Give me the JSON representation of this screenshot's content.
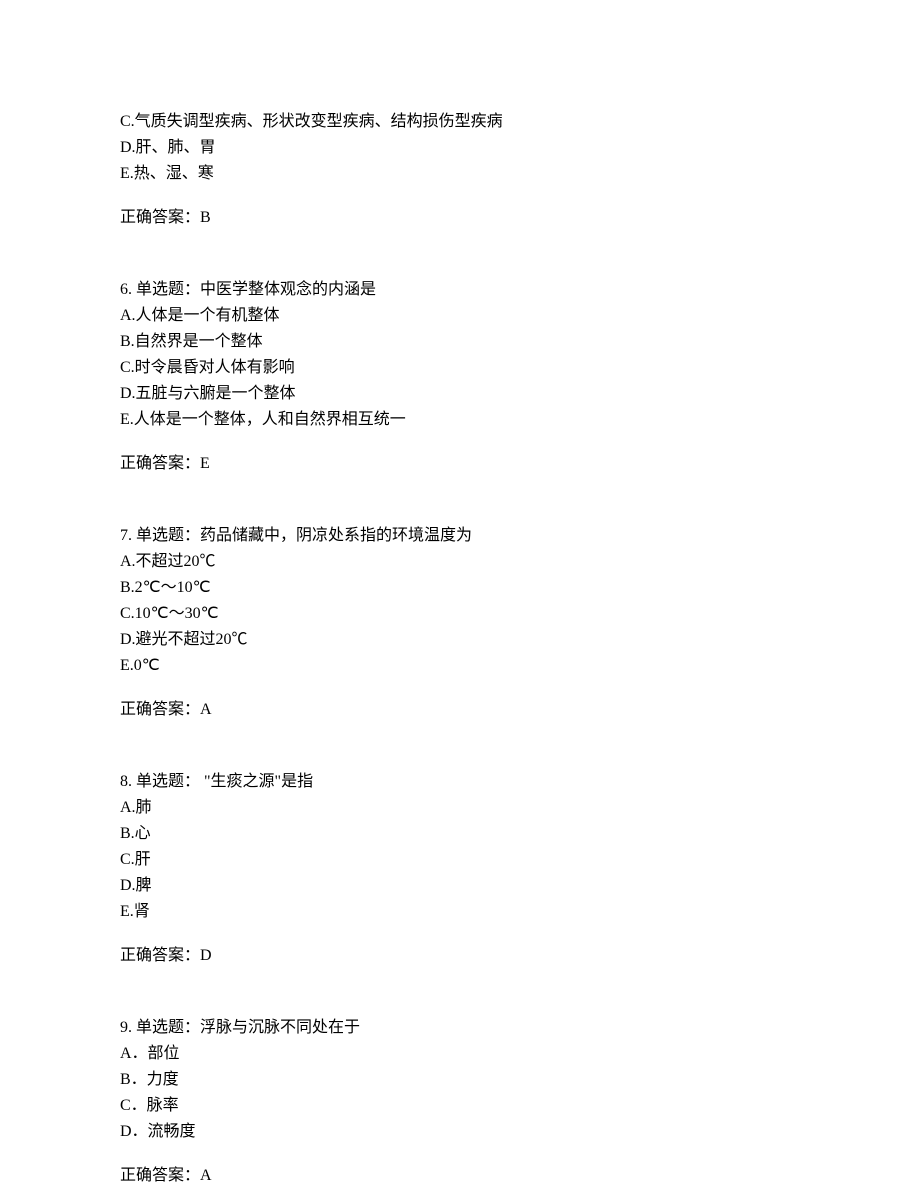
{
  "q5_tail": {
    "options": [
      "C.气质失调型疾病、形状改变型疾病、结构损伤型疾病",
      "D.肝、肺、胃",
      "E.热、湿、寒"
    ],
    "answer": "正确答案：B"
  },
  "q6": {
    "stem": "6.  单选题：中医学整体观念的内涵是",
    "options": [
      "A.人体是一个有机整体",
      "B.自然界是一个整体",
      "C.时令晨昏对人体有影响",
      "D.五脏与六腑是一个整体",
      "E.人体是一个整体，人和自然界相互统一"
    ],
    "answer": "正确答案：E"
  },
  "q7": {
    "stem": "7.  单选题：药品储藏中，阴凉处系指的环境温度为",
    "options": [
      "A.不超过20℃",
      "B.2℃～10℃",
      "C.10℃～30℃",
      "D.避光不超过20℃",
      "E.0℃"
    ],
    "answer": "正确答案：A"
  },
  "q8": {
    "stem": "8.  单选题： \"生痰之源\"是指",
    "options": [
      "A.肺",
      "B.心",
      "C.肝",
      "D.脾",
      "E.肾"
    ],
    "answer": "正确答案：D"
  },
  "q9": {
    "stem": "9.  单选题：浮脉与沉脉不同处在于",
    "options": [
      "A．部位",
      "B．力度",
      "C．脉率",
      "D．流畅度"
    ],
    "answer": "正确答案：A"
  }
}
